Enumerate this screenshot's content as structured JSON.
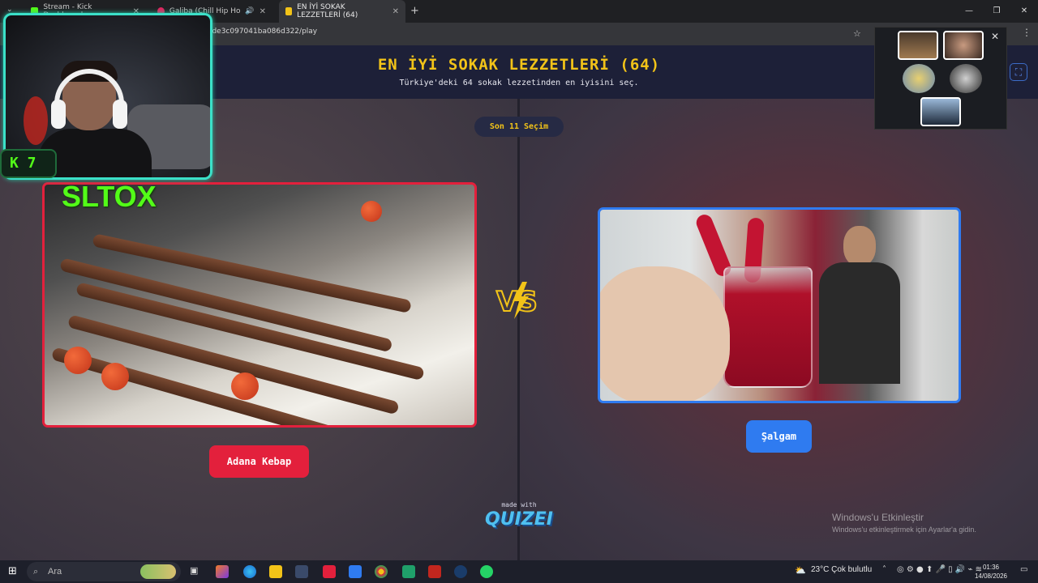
{
  "browser": {
    "tabs": [
      {
        "title": "Stream - Kick Dashboard",
        "favicon_color": "#53fc18"
      },
      {
        "title": "Galiba (Chill Hip Hop Mix)",
        "favicon_color": "#e0245e"
      },
      {
        "title": "EN İYİ SOKAK LEZZETLERİ (64)",
        "favicon_color": "#f2c318"
      }
    ],
    "new_tab": "+",
    "url": "78de3c097041ba086d322/play",
    "window_controls": [
      "—",
      "❐",
      "✕"
    ]
  },
  "quiz": {
    "title": "EN İYİ SOKAK LEZZETLERİ (64)",
    "subtitle": "Türkiye'deki 64 sokak lezzetinden en iyisini seç.",
    "round_label": "Son 11 Seçim",
    "left_option": {
      "label": "Adana Kebap",
      "color": "#e3203c"
    },
    "right_option": {
      "label": "Şalgam",
      "color": "#2f7bf0"
    },
    "vs_text": "VS",
    "made_with": "made with",
    "brand": "QUIZEI"
  },
  "stream_overlay": {
    "streamer_name": "SLTOX",
    "kick_badge": "K 7"
  },
  "windows": {
    "activation_title": "Windows'u Etkinleştir",
    "activation_sub": "Windows'u etkinleştirmek için Ayarlar'a gidin."
  },
  "taskbar": {
    "search_placeholder": "Ara",
    "weather": "23°C  Çok bulutlu",
    "time": "01:36",
    "date": "14/08/2026"
  }
}
